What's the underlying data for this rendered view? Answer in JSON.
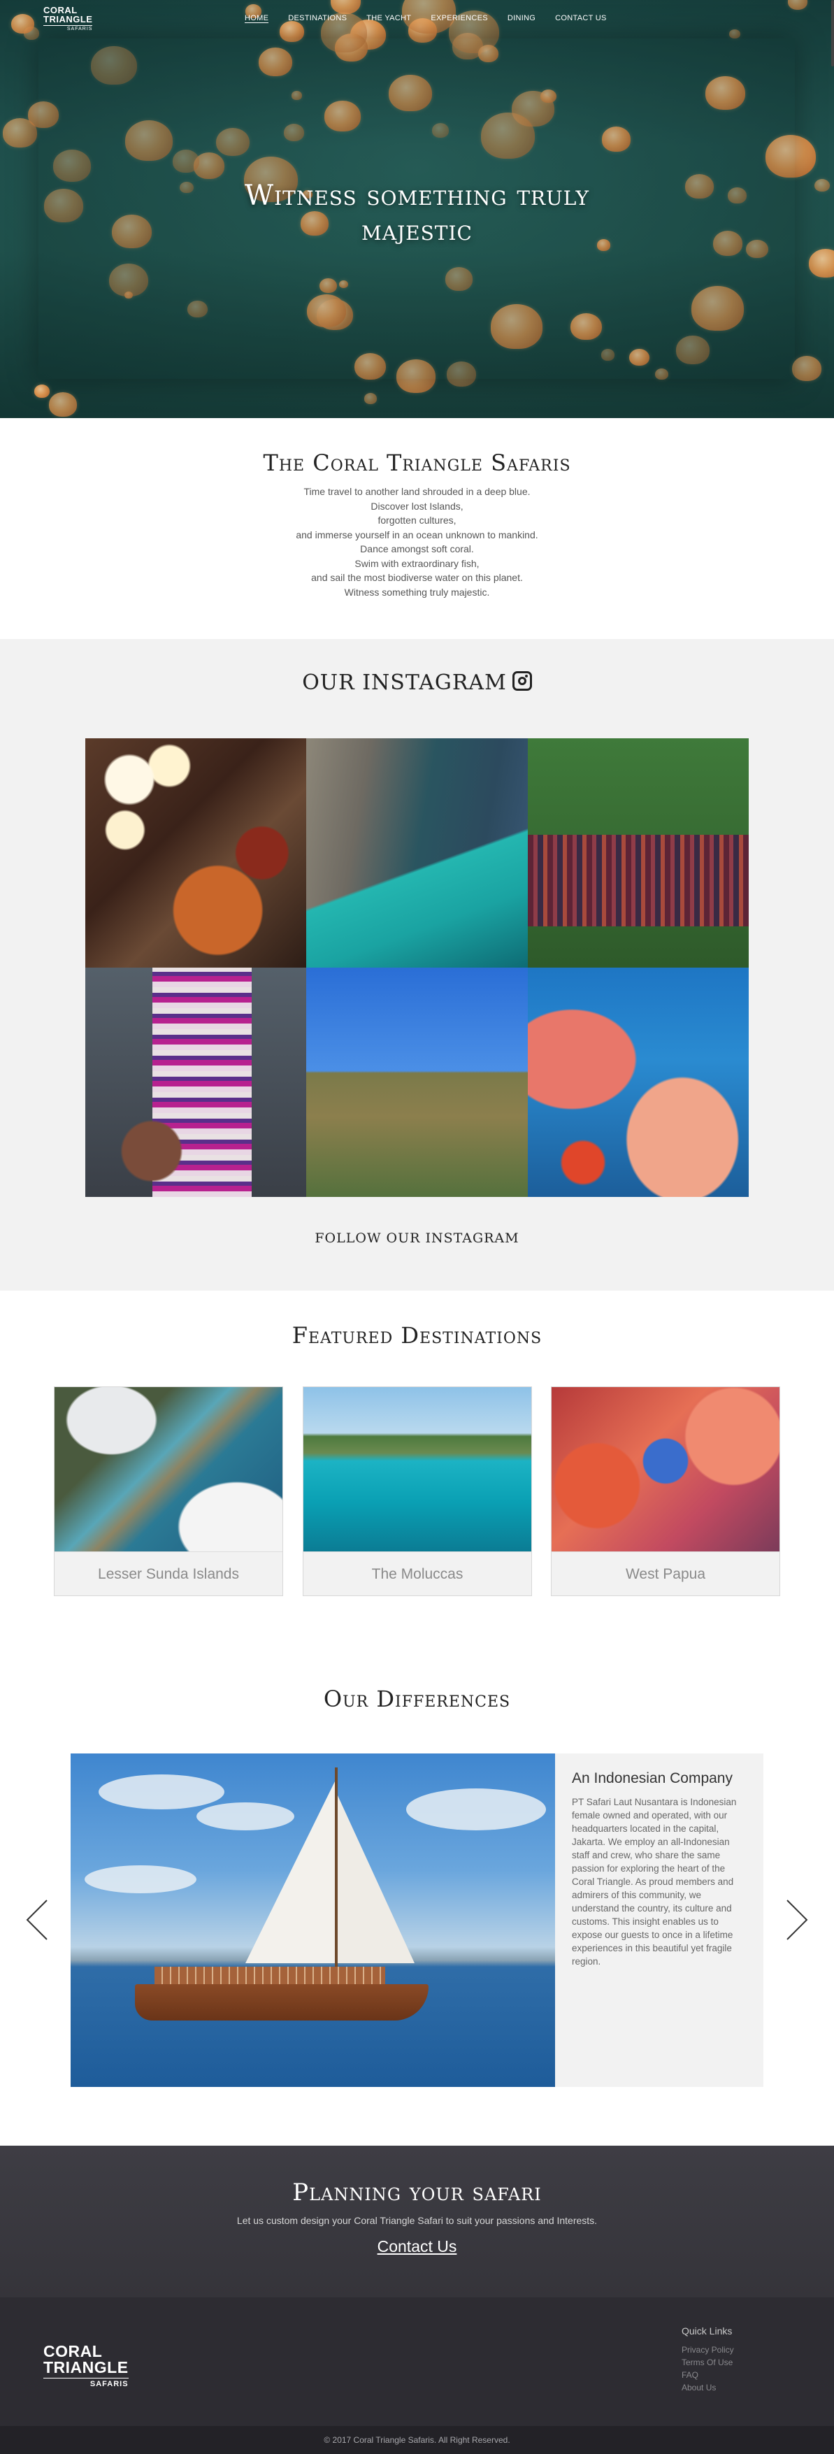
{
  "brand": {
    "line1": "CORAL",
    "line2": "TRIANGLE",
    "line3": "SAFARIS"
  },
  "nav": {
    "items": [
      "HOME",
      "DESTINATIONS",
      "THE YACHT",
      "EXPERIENCES",
      "DINING",
      "CONTACT US"
    ],
    "active": "HOME"
  },
  "hero": {
    "line1": "Witness something truly",
    "line2": "majestic"
  },
  "intro": {
    "title": "The Coral Triangle Safaris",
    "lines": [
      "Time travel to another land shrouded in a deep blue.",
      "Discover lost Islands,",
      "forgotten cultures,",
      "and immerse yourself in an ocean unknown to mankind.",
      "Dance amongst soft coral.",
      "Swim with extraordinary fish,",
      "and sail the most biodiverse water on this planet.",
      "Witness something truly majestic."
    ]
  },
  "instagram": {
    "title": "OUR INSTAGRAM",
    "icon": "instagram-icon",
    "follow": "FOLLOW OUR INSTAGRAM"
  },
  "featured": {
    "title": "Featured Destinations",
    "destinations": [
      "Lesser Sunda Islands",
      "The Moluccas",
      "West Papua"
    ]
  },
  "differences": {
    "title": "Our Differences",
    "slide_heading": "An Indonesian Company",
    "slide_text": "PT Safari Laut Nusantara is Indonesian female owned and operated, with our headquarters located in the capital, Jakarta. We employ an all-Indonesian staff and crew, who share the same passion for exploring the heart of the Coral Triangle. As proud members and admirers of this community, we understand the country, its culture and customs. This insight enables us to expose our guests to once in a lifetime experiences in this beautiful yet fragile region."
  },
  "planning": {
    "title": "Planning your safari",
    "subtitle": "Let us custom design your Coral Triangle Safari to suit your passions and Interests.",
    "cta": "Contact Us"
  },
  "footer": {
    "quick_title": "Quick Links",
    "links": [
      "Privacy Policy",
      "Terms Of Use",
      "FAQ",
      "About Us"
    ],
    "copyright": "© 2017 Coral Triangle Safaris. All Right Reserved."
  },
  "colors": {
    "hero_teal": "#2c6862",
    "section_gray": "#f2f2f2",
    "planning_bg": "#3e3d44",
    "footer_bg": "#2d2c32"
  }
}
